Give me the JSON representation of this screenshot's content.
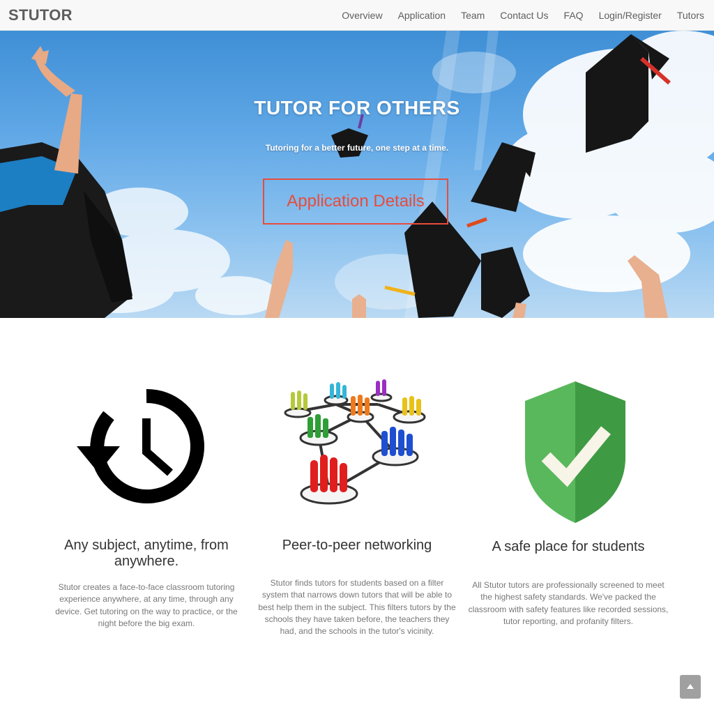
{
  "navbar": {
    "brand": "STUTOR",
    "items": [
      {
        "label": "Overview"
      },
      {
        "label": "Application"
      },
      {
        "label": "Team"
      },
      {
        "label": "Contact Us"
      },
      {
        "label": "FAQ"
      },
      {
        "label": "Login/Register"
      },
      {
        "label": "Tutors"
      }
    ]
  },
  "hero": {
    "title": "TUTOR FOR OTHERS",
    "subtitle": "Tutoring for a better future, one step at a time.",
    "button_label": "Application Details",
    "accent_color": "#e74c3c",
    "image": "graduation-caps-thrown-in-sky"
  },
  "features": [
    {
      "icon": "history-clock-icon",
      "heading": "Any subject, anytime, from anywhere.",
      "text": "Stutor creates a face-to-face classroom tutoring experience anywhere, at any time, through any device. Get tutoring on the way to practice, or the night before the big exam."
    },
    {
      "icon": "peer-network-icon",
      "heading": "Peer-to-peer networking",
      "text": "Stutor finds tutors for students based on a filter system that narrows down tutors that will be able to best help them in the subject. This filters tutors by the schools they have taken before, the teachers they had, and the schools in the tutor's vicinity."
    },
    {
      "icon": "shield-check-icon",
      "heading": "A safe place for students",
      "text": "All Stutor tutors are professionally screened to meet the highest safety standards. We've packed the classroom with safety features like recorded sessions, tutor reporting, and profanity filters."
    }
  ],
  "back_to_top": {
    "icon": "chevron-up-icon"
  }
}
